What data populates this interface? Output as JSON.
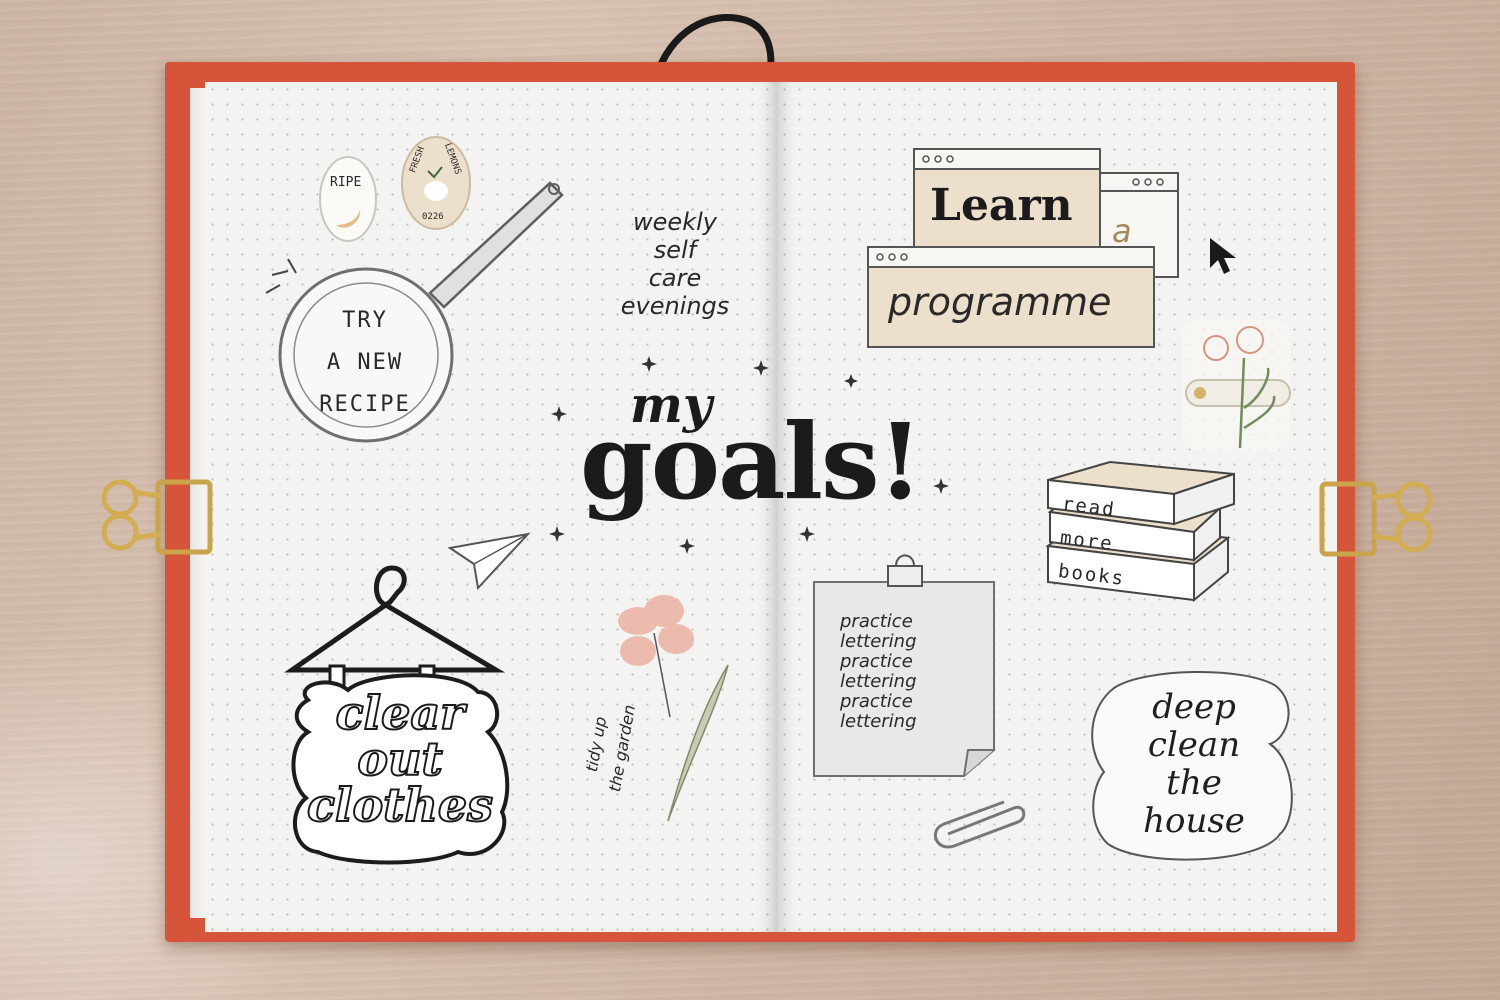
{
  "title": {
    "line1": "my",
    "line2": "goals!"
  },
  "stickers": {
    "ripe": "RIPE",
    "fresh": "FRESH",
    "lemons": "LEMONS",
    "code": "0226"
  },
  "goals": {
    "recipe": [
      "TRY",
      "A NEW",
      "RECIPE"
    ],
    "selfcare": [
      "weekly",
      "self",
      "care",
      "evenings"
    ],
    "learn": "Learn",
    "a": "a",
    "programme": "programme",
    "books": [
      "read",
      "more",
      "books"
    ],
    "lettering": [
      "practice",
      "lettering",
      "practice",
      "lettering",
      "practice",
      "lettering"
    ],
    "clothes": [
      "clear",
      "out",
      "clothes"
    ],
    "garden": [
      "tidy up",
      "the garden"
    ],
    "house": [
      "deep",
      "clean",
      "the",
      "house"
    ]
  },
  "colors": {
    "cover": "#d6553a",
    "paper": "#f3f3f1",
    "beige": "#ece0cc",
    "ink": "#1c1a1a",
    "pink": "#e9a99a"
  }
}
